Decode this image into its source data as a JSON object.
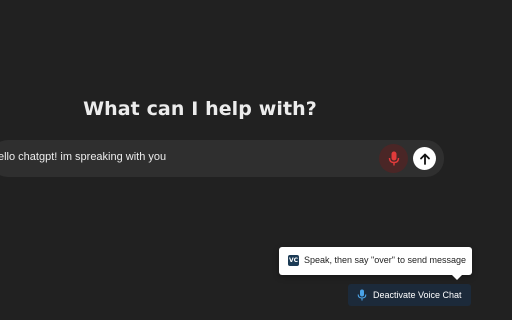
{
  "main": {
    "heading": "What can I help with?"
  },
  "composer": {
    "text": "ello chatgpt! im spreaking with you",
    "mic_icon": "microphone-icon",
    "send_icon": "arrow-up-icon"
  },
  "extension": {
    "tooltip_logo": "VC",
    "tooltip_text": "Speak, then say \"over\" to send message",
    "toggle_label": "Deactivate Voice Chat",
    "toggle_icon": "microphone-icon"
  },
  "colors": {
    "background": "#212121",
    "composer": "#2f2f2f",
    "mic_active": "#e23b3b",
    "voice_button": "#1c2a3a",
    "voice_icon": "#4aa3e8"
  }
}
